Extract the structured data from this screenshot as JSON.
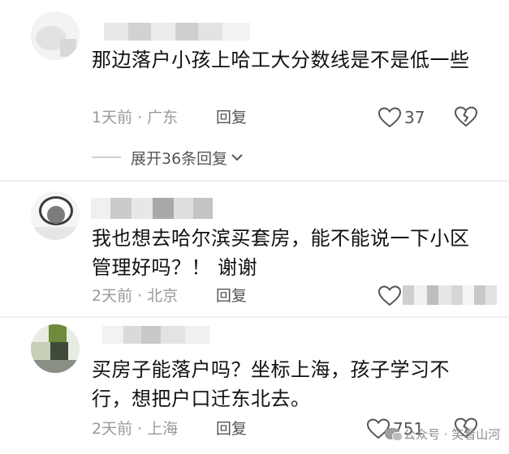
{
  "comments": [
    {
      "text": "那边落户小孩上哈工大分数线是不是低一些",
      "time": "1天前",
      "location": "广东",
      "reply_label": "回复",
      "likes": "37"
    },
    {
      "text": "我也想去哈尔滨买套房，能不能说一下小区管理好吗？！ 谢谢",
      "time": "2天前",
      "location": "北京",
      "reply_label": "回复",
      "likes": ""
    },
    {
      "text": "买房子能落户吗？坐标上海，孩子学习不行，想把户口迁东北去。",
      "time": "2天前",
      "location": "上海",
      "reply_label": "回复",
      "likes": "751"
    }
  ],
  "expand_replies": "展开36条回复",
  "dot": "·",
  "watermark": "公众号 · 笑看山河",
  "colors": {
    "text": "#111111",
    "meta": "#9a9a9a",
    "action": "#555555"
  },
  "icons": [
    "heart-icon",
    "broken-heart-icon",
    "chevron-down-icon",
    "wechat-icon"
  ]
}
